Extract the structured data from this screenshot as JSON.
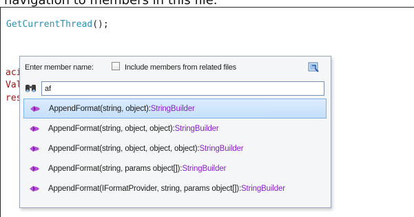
{
  "caption": "navigation to members in this file.",
  "code": {
    "line1_identifier": "GetCurrentThread",
    "line1_punct": "();",
    "fragments": [
      "aci",
      "Val",
      "res"
    ]
  },
  "popup": {
    "member_label": "Enter member name:",
    "include_related_label": "Include members from related files",
    "include_related_checked": false,
    "search_value": "af",
    "results": [
      {
        "signature": "AppendFormat(string, object):",
        "return_type": "StringBuilder",
        "selected": true
      },
      {
        "signature": "AppendFormat(string, object, object):",
        "return_type": "StringBuilder",
        "selected": false
      },
      {
        "signature": "AppendFormat(string, object, object, object):",
        "return_type": "StringBuilder",
        "selected": false
      },
      {
        "signature": "AppendFormat(string, params object[]):",
        "return_type": "StringBuilder",
        "selected": false
      },
      {
        "signature": "AppendFormat(IFormatProvider, string, params object[]):",
        "return_type": "StringBuilder",
        "selected": false
      }
    ],
    "icons": {
      "search": "binoculars-icon",
      "pin": "pin-icon",
      "method": "method-icon"
    }
  },
  "colors": {
    "identifier": "#2b91af",
    "string_fragment": "#a31515",
    "return_type": "#8b1ecf",
    "selection": "#c5e0fb",
    "method_icon": "#b44fd6"
  }
}
